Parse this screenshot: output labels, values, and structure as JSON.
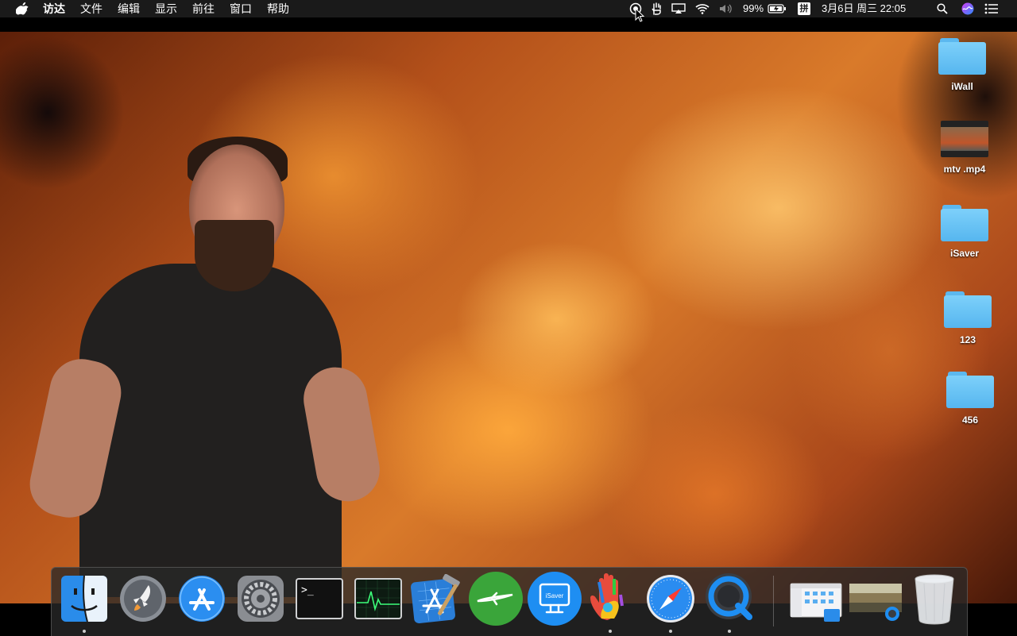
{
  "menubar": {
    "app_name": "访达",
    "items": [
      "文件",
      "编辑",
      "显示",
      "前往",
      "窗口",
      "帮助"
    ],
    "battery": "99%",
    "input_method": "拼",
    "datetime": "3月6日 周三 22:05"
  },
  "desktop": {
    "items": [
      {
        "label": "iWall",
        "kind": "folder"
      },
      {
        "label": "mtv .mp4",
        "kind": "video"
      },
      {
        "label": "iSaver",
        "kind": "folder"
      },
      {
        "label": "123",
        "kind": "folder"
      },
      {
        "label": "456",
        "kind": "folder"
      }
    ]
  },
  "dock": {
    "apps": [
      {
        "icon": "finder-icon",
        "running": true
      },
      {
        "icon": "launchpad-icon",
        "running": false
      },
      {
        "icon": "app-store-icon",
        "running": false
      },
      {
        "icon": "system-preferences-icon",
        "running": false
      },
      {
        "icon": "terminal-icon",
        "running": false
      },
      {
        "icon": "activity-monitor-icon",
        "running": false
      },
      {
        "icon": "xcode-icon",
        "running": false
      },
      {
        "icon": "airplane-app-icon",
        "running": false
      },
      {
        "icon": "isaver-app-icon",
        "running": false,
        "label": "iSaver"
      },
      {
        "icon": "painted-hand-icon",
        "running": true
      },
      {
        "icon": "safari-icon",
        "running": true
      },
      {
        "icon": "quicktime-icon",
        "running": true
      },
      {
        "icon": "finder-window-thumbnail-icon",
        "running": false
      },
      {
        "icon": "wallpaper-window-thumbnail-icon",
        "running": false
      },
      {
        "icon": "trash-icon",
        "running": false
      }
    ]
  }
}
